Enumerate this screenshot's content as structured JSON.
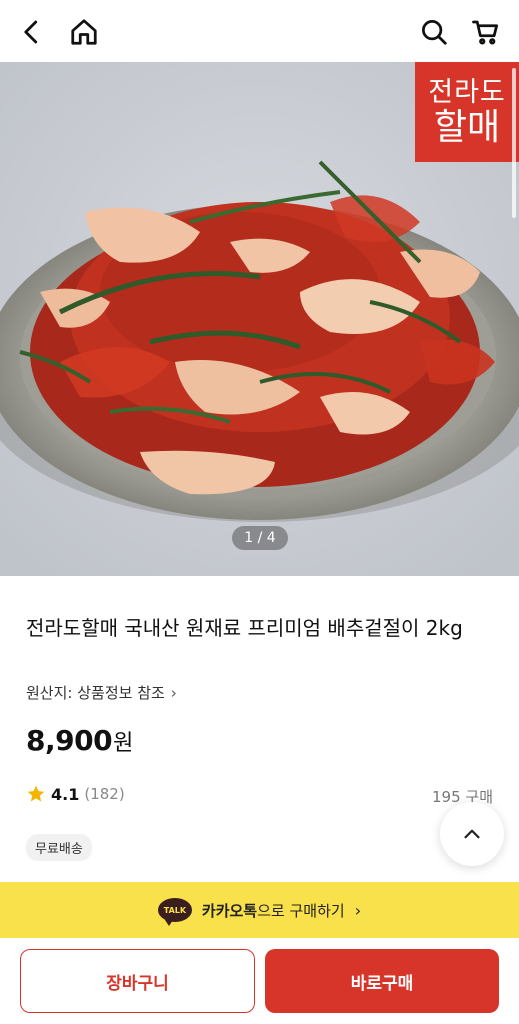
{
  "topbar": {
    "back": "back-icon",
    "home": "home-icon",
    "search": "search-icon",
    "cart": "cart-icon"
  },
  "hero": {
    "brand_line1": "전라도",
    "brand_line2": "할매",
    "page_indicator": "1 / 4"
  },
  "product": {
    "title": "전라도할매 국내산 원재료 프리미엄 배추겉절이 2kg",
    "origin": "원산지: 상품정보 참조",
    "origin_chevron": "›",
    "price": "8,900",
    "price_unit": "원",
    "rating": "4.1",
    "review_count": "(182)",
    "sold": "195 구매",
    "badge": "무료배송"
  },
  "kakao": {
    "talk_label": "TALK",
    "brand": "카카오톡",
    "suffix": "으로 구매하기",
    "chevron": "›"
  },
  "actions": {
    "cart_label": "장바구니",
    "buy_label": "바로구매"
  },
  "colors": {
    "accent": "#d8352a",
    "kakao_yellow": "#f9e14b",
    "star": "#f5b400"
  }
}
